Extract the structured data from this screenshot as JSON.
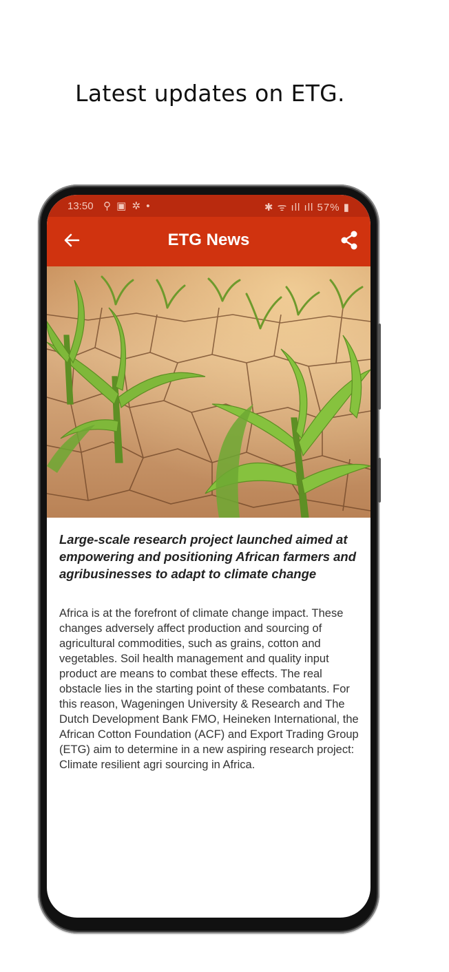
{
  "page": {
    "headline": "Latest updates on ETG."
  },
  "status_bar": {
    "time": "13:50",
    "left_icons": "⚲ ▣ ✲ •",
    "right_icons": "✱ ᯤ ıll ıll",
    "battery": "57%"
  },
  "app_bar": {
    "title": "ETG News",
    "back_icon": "arrow-left-icon",
    "share_icon": "share-icon",
    "color": "#d0330f"
  },
  "article": {
    "title": "Large-scale research project launched aimed at empowering and positioning African farmers and agribusinesses to adapt to climate change",
    "body": "Africa is at the forefront of climate change impact. These changes adversely affect production and sourcing of agricultural commodities, such as grains, cotton and vegetables. Soil health management and quality input product are means to combat these effects. The real obstacle lies in the starting point of these combatants. For this reason, Wageningen University & Research and The Dutch Development Bank FMO, Heineken International, the African Cotton Foundation (ACF) and Export Trading Group (ETG) aim to determine in a new aspiring research project: Climate resilient agri sourcing in Africa."
  }
}
